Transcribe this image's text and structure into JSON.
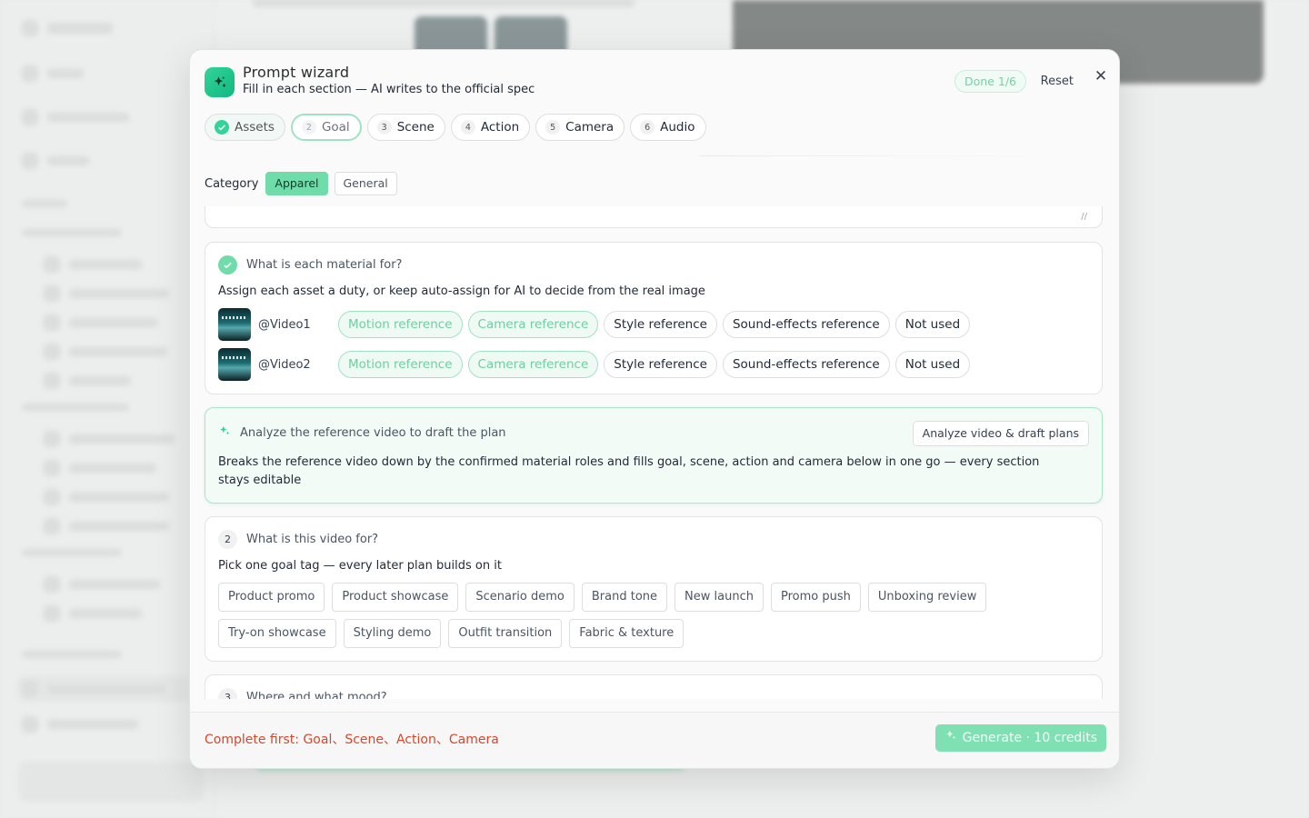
{
  "modal": {
    "title": "Prompt wizard",
    "subtitle": "Fill in each section — AI writes to the official spec",
    "done_label": "Done 1/6",
    "reset_label": "Reset",
    "close_glyph": "✕"
  },
  "steps": [
    {
      "num": "✓",
      "label": "Assets"
    },
    {
      "num": "2",
      "label": "Goal"
    },
    {
      "num": "3",
      "label": "Scene"
    },
    {
      "num": "4",
      "label": "Action"
    },
    {
      "num": "5",
      "label": "Camera"
    },
    {
      "num": "6",
      "label": "Audio"
    }
  ],
  "category": {
    "label": "Category",
    "options": [
      "Apparel",
      "General"
    ],
    "selected": "Apparel"
  },
  "materials": {
    "question": "What is each material for?",
    "hint": "Assign each asset a duty, or keep auto-assign for AI to decide from the real image",
    "roles": [
      "Motion reference",
      "Camera reference",
      "Style reference",
      "Sound-effects reference",
      "Not used"
    ],
    "assets": [
      {
        "name": "@Video1",
        "selected_roles": [
          "Motion reference",
          "Camera reference"
        ]
      },
      {
        "name": "@Video2",
        "selected_roles": [
          "Motion reference",
          "Camera reference"
        ]
      }
    ]
  },
  "analyze": {
    "title": "Analyze the reference video to draft the plan",
    "button": "Analyze video & draft plans",
    "description": "Breaks the reference video down by the confirmed material roles and fills goal, scene, action and camera below in one go — every section stays editable"
  },
  "goal": {
    "num": "2",
    "question": "What is this video for?",
    "hint": "Pick one goal tag — every later plan builds on it",
    "tags": [
      "Product promo",
      "Product showcase",
      "Scenario demo",
      "Brand tone",
      "New launch",
      "Promo push",
      "Unboxing review",
      "Try-on showcase",
      "Styling demo",
      "Outfit transition",
      "Fabric & texture"
    ]
  },
  "scene": {
    "num": "3",
    "question": "Where and what mood?"
  },
  "footer": {
    "warning": "Complete first: Goal、Scene、Action、Camera",
    "generate": "Generate · 10 credits"
  },
  "icons": {
    "logo": "sparkles-icon",
    "accent": "#34d399",
    "warning_color": "#d9472b"
  }
}
